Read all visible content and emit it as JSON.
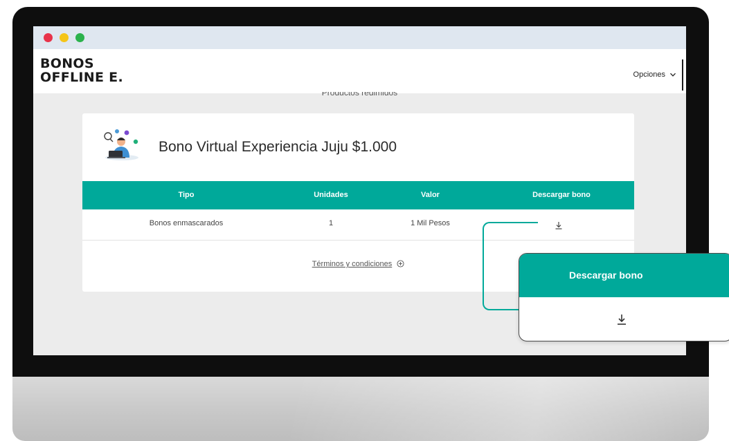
{
  "window": {
    "controls": [
      "close",
      "minimize",
      "maximize"
    ]
  },
  "header": {
    "logo_line1": "BONOS",
    "logo_line2": "OFFLINE E.",
    "options_label": "Opciones"
  },
  "section_title": "Productos redimidos",
  "product": {
    "title": "Bono Virtual Experiencia Juju $1.000",
    "illustration_icon": "person-with-icons-illustration"
  },
  "table": {
    "columns": [
      "Tipo",
      "Unidades",
      "Valor",
      "Descargar bono"
    ],
    "rows": [
      {
        "tipo": "Bonos enmascarados",
        "unidades": "1",
        "valor": "1 Mil Pesos",
        "download_icon": "download-icon"
      }
    ]
  },
  "terms": {
    "label": "Términos y condiciones",
    "icon": "plus-circle-icon"
  },
  "callout": {
    "header": "Descargar bono",
    "icon": "download-icon"
  },
  "colors": {
    "accent": "#00a99a",
    "titlebar": "#dfe7f0",
    "background": "#ececec",
    "close": "#e8334a",
    "minimize": "#f5c518",
    "maximize": "#2bb24c"
  }
}
